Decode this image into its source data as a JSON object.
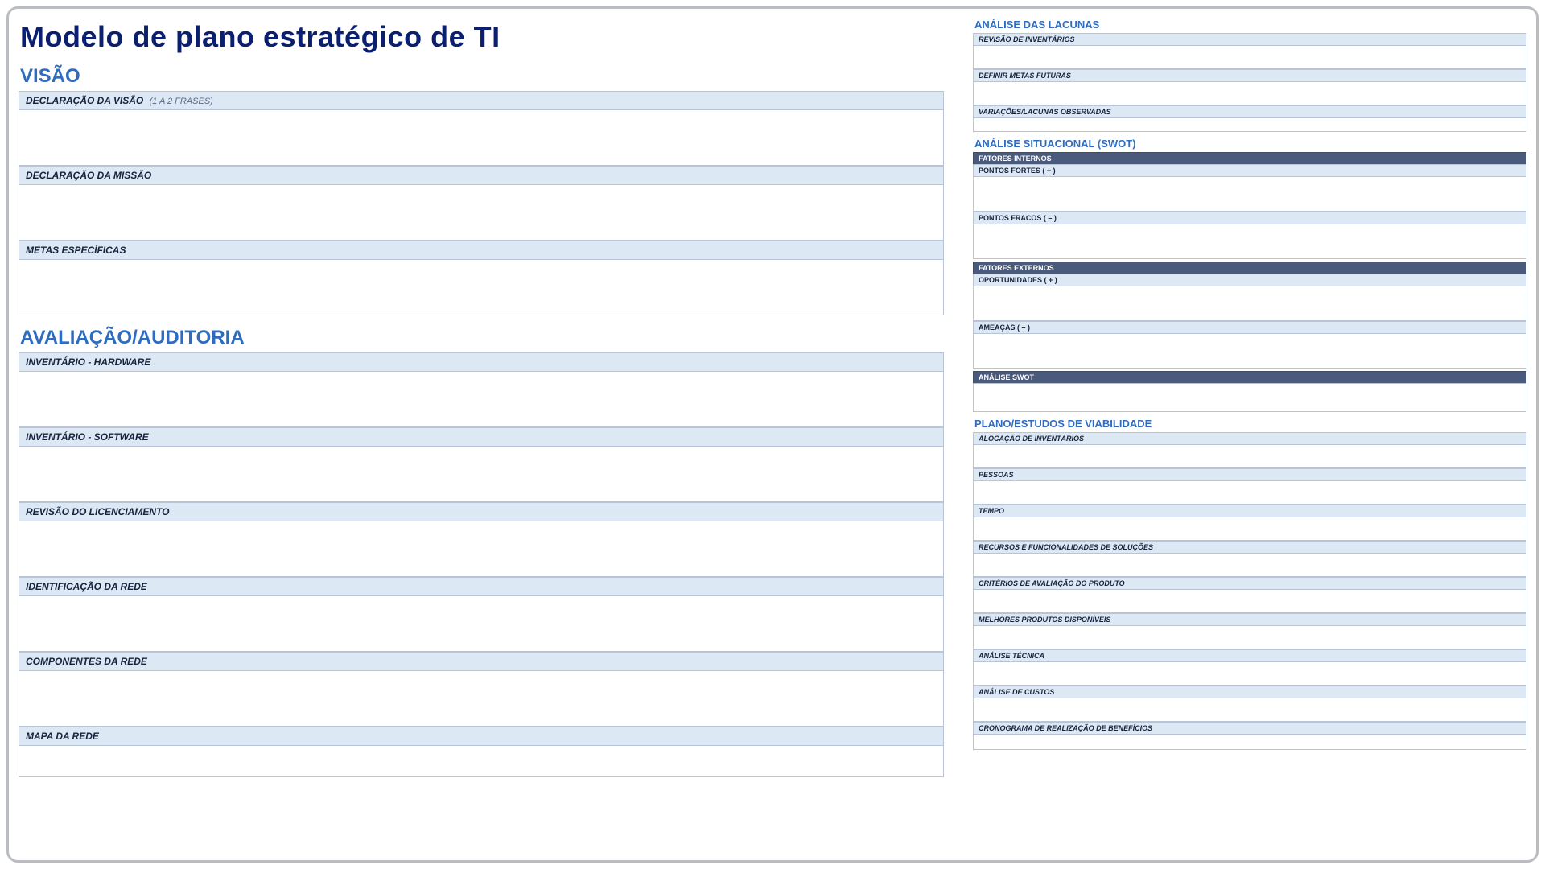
{
  "title": "Modelo de plano estratégico de TI",
  "left": {
    "visao": {
      "section": "VISÃO",
      "declaracao_visao": {
        "label": "DECLARAÇÃO DA VISÃO",
        "hint": "(1 A 2 FRASES)"
      },
      "declaracao_missao": {
        "label": "DECLARAÇÃO DA MISSÃO"
      },
      "metas_especificas": {
        "label": "METAS ESPECÍFICAS"
      }
    },
    "avaliacao": {
      "section": "AVALIAÇÃO/AUDITORIA",
      "inventario_hardware": {
        "label": "INVENTÁRIO - HARDWARE"
      },
      "inventario_software": {
        "label": "INVENTÁRIO - SOFTWARE"
      },
      "revisao_licenciamento": {
        "label": "REVISÃO DO LICENCIAMENTO"
      },
      "identificacao_rede": {
        "label": "IDENTIFICAÇÃO DA REDE"
      },
      "componentes_rede": {
        "label": "COMPONENTES DA REDE"
      },
      "mapa_rede": {
        "label": "MAPA DA REDE"
      }
    }
  },
  "right": {
    "lacunas": {
      "section": "ANÁLISE DAS LACUNAS",
      "revisao_inventarios": {
        "label": "REVISÃO DE INVENTÁRIOS"
      },
      "definir_metas": {
        "label": "DEFINIR METAS FUTURAS"
      },
      "variacoes": {
        "label": "VARIAÇÕES/LACUNAS OBSERVADAS"
      }
    },
    "swot": {
      "section": "ANÁLISE SITUACIONAL (SWOT)",
      "fatores_internos": "FATORES INTERNOS",
      "pontos_fortes": "PONTOS FORTES ( + )",
      "pontos_fracos": "PONTOS FRACOS ( – )",
      "fatores_externos": "FATORES EXTERNOS",
      "oportunidades": "OPORTUNIDADES ( + )",
      "ameacas": "AMEAÇAS ( – )",
      "analise_swot": "ANÁLISE SWOT"
    },
    "viabilidade": {
      "section": "PLANO/ESTUDOS DE VIABILIDADE",
      "alocacao_inventarios": "ALOCAÇÃO DE INVENTÁRIOS",
      "pessoas": "PESSOAS",
      "tempo": "TEMPO",
      "recursos_funcionalidades": "RECURSOS E FUNCIONALIDADES DE SOLUÇÕES",
      "criterios_avaliacao": "CRITÉRIOS DE AVALIAÇÃO DO PRODUTO",
      "melhores_produtos": "MELHORES PRODUTOS DISPONÍVEIS",
      "analise_tecnica": "ANÁLISE TÉCNICA",
      "analise_custos": "ANÁLISE DE CUSTOS",
      "cronograma_beneficios": "CRONOGRAMA DE REALIZAÇÃO DE BENEFÍCIOS"
    }
  }
}
